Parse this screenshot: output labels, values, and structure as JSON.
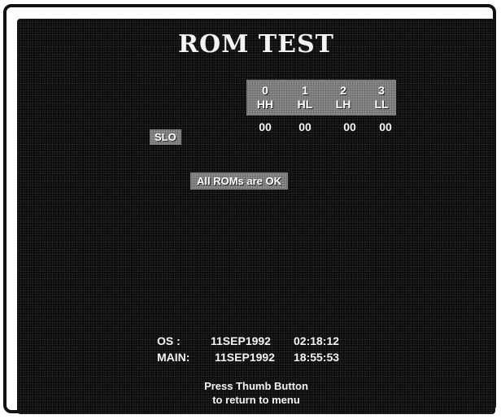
{
  "screen": {
    "title": "ROM TEST",
    "rom_columns": [
      {
        "index": "0",
        "code": "HH",
        "value": "00"
      },
      {
        "index": "1",
        "code": "HL",
        "value": "00"
      },
      {
        "index": "2",
        "code": "LH",
        "value": "00"
      },
      {
        "index": "3",
        "code": "LL",
        "value": "00"
      }
    ],
    "slo_label": "SLO",
    "status_message": "All ROMs are OK",
    "versions": {
      "os_label": "OS :",
      "os_date": "11SEP1992",
      "os_time": "02:18:12",
      "main_label": "MAIN:",
      "main_date": "11SEP1992",
      "main_time": "18:55:53"
    },
    "footer": {
      "line1": "Press Thumb Button",
      "line2": "to return to menu"
    }
  },
  "colors": {
    "background": "#0a0a0a",
    "text": "#f4f4f4",
    "highlight": "#8a8a8a",
    "frame": "#111111"
  }
}
